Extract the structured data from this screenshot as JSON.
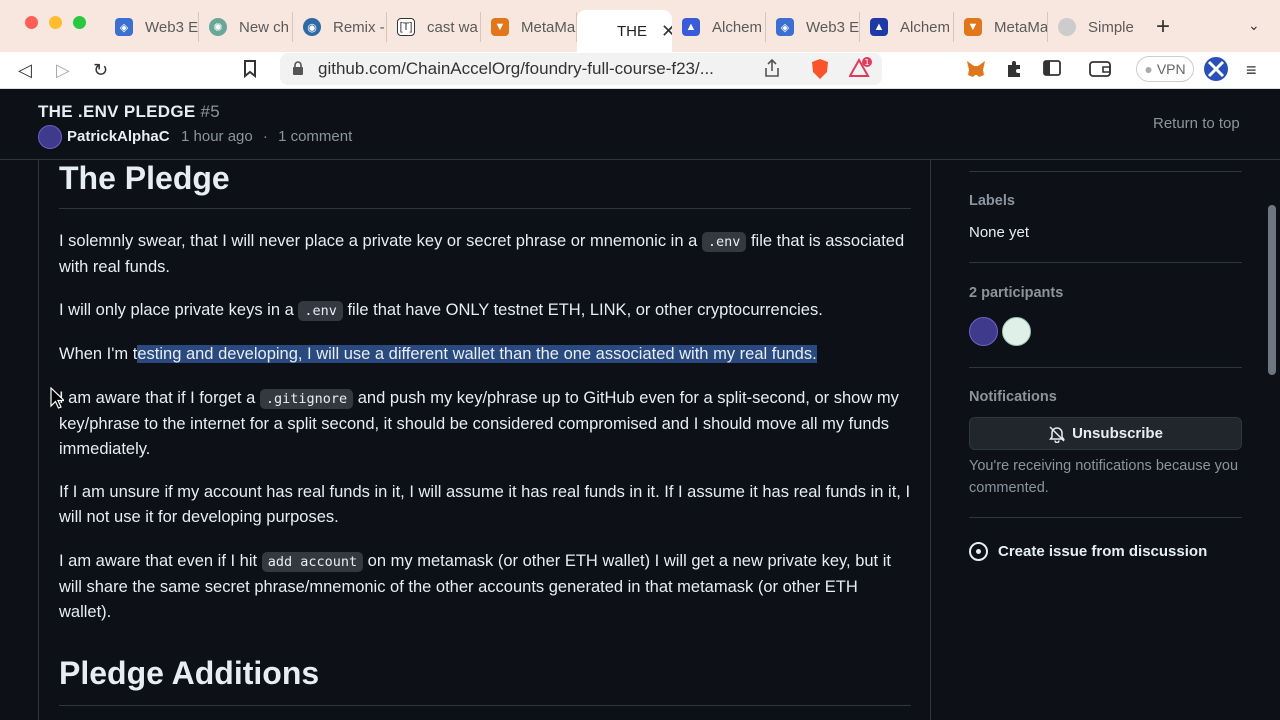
{
  "browser": {
    "tabs": [
      {
        "label": "Web3 E",
        "icon": "web3-icon",
        "color": "#3b6fd1"
      },
      {
        "label": "New ch",
        "icon": "chatgpt-icon",
        "color": "#6aa79a"
      },
      {
        "label": "Remix -",
        "icon": "remix-icon",
        "color": "#2e6ba5"
      },
      {
        "label": "cast wa",
        "icon": "foundry-book-icon",
        "color": "#333333"
      },
      {
        "label": "MetaMa",
        "icon": "metamask-icon",
        "color": "#e2761b"
      },
      {
        "label": "THE",
        "icon": "github-icon",
        "color": "#ffffff"
      },
      {
        "label": "Alchem",
        "icon": "alchemy-icon",
        "color": "#3a5bd9"
      },
      {
        "label": "Web3 E",
        "icon": "web3-icon",
        "color": "#3b6fd1"
      },
      {
        "label": "Alchem",
        "icon": "alchemy-icon",
        "color": "#1f3aa8"
      },
      {
        "label": "MetaMa",
        "icon": "metamask-icon",
        "color": "#e2761b"
      },
      {
        "label": "Simple",
        "icon": "simple-icon",
        "color": "#cccccc"
      }
    ],
    "url": "github.com/ChainAccelOrg/foundry-full-course-f23/...",
    "vpn_label": "VPN",
    "brave_badge": "1"
  },
  "header": {
    "title": "THE .ENV PLEDGE",
    "number": "#5",
    "author": "PatrickAlphaC",
    "time": "1 hour ago",
    "separator": "·",
    "comments": "1 comment",
    "return_top": "Return to top"
  },
  "content": {
    "heading": "The Pledge",
    "p1_a": "I solemnly swear, that I will never place a private key or secret phrase or mnemonic in a ",
    "p1_code": ".env",
    "p1_b": " file that is associated with real funds.",
    "p2_a": "I will only place private keys in a ",
    "p2_code": ".env",
    "p2_b": " file that have ONLY testnet ETH, LINK, or other cryptocurrencies.",
    "p3_a": "When I'm t",
    "p3_hl": "esting and developing, I will use a different wallet than the one associated with my real funds.",
    "p4_a": "I am aware that if I forget a ",
    "p4_code": ".gitignore",
    "p4_b": " and push my key/phrase up to GitHub even for a split-second, or show my key/phrase to the internet for a split second, it should be considered compromised and I should move all my funds immediately.",
    "p5": "If I am unsure if my account has real funds in it, I will assume it has real funds in it. If I assume it has real funds in it, I will not use it for developing purposes.",
    "p6_a": "I am aware that even if I hit ",
    "p6_code": "add account",
    "p6_b": " on my metamask (or other ETH wallet) I will get a new private key, but it will share the same secret phrase/mnemonic of the other accounts generated in that metamask (or other ETH wallet).",
    "heading2": "Pledge Additions"
  },
  "sidebar": {
    "labels_title": "Labels",
    "labels_value": "None yet",
    "participants_title": "2 participants",
    "notifications_title": "Notifications",
    "unsubscribe": "Unsubscribe",
    "notif_reason": "You're receiving notifications because you commented.",
    "create_issue": "Create issue from discussion"
  }
}
